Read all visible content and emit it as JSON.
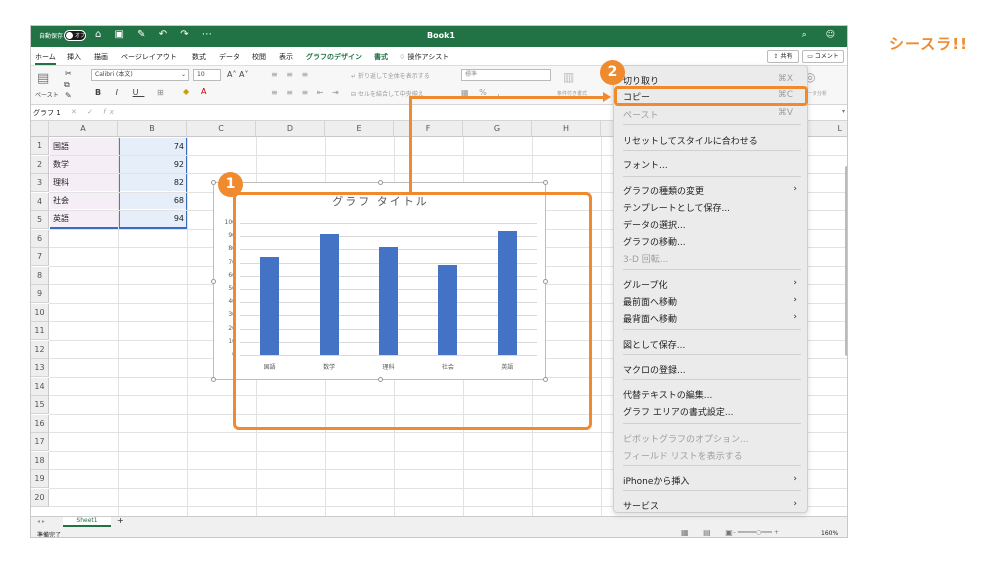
{
  "window": {
    "autosave_label": "自動保存",
    "autosave_state": "オフ",
    "title": "Book1"
  },
  "menu_tabs": [
    "ホーム",
    "挿入",
    "描画",
    "ページレイアウト",
    "数式",
    "データ",
    "校閲",
    "表示",
    "グラフのデザイン",
    "書式",
    "操作アシスト"
  ],
  "share_label": "共有",
  "comment_label": "コメント",
  "ribbon": {
    "paste_label": "ペースト",
    "font_name": "Calibri (本文)",
    "font_size": "10",
    "wrap_text": "折り返して全体を表示する",
    "merge_center": "セルを結合して中央揃え",
    "number_format": "標準",
    "cond_format": "条件付き書式",
    "data_analysis": "データ分析"
  },
  "formula_bar": {
    "name_box": "グラフ 1",
    "fx": "fx"
  },
  "columns": [
    "A",
    "B",
    "C",
    "D",
    "E",
    "F",
    "G",
    "H",
    "L"
  ],
  "rows": [
    "1",
    "2",
    "3",
    "4",
    "5",
    "6",
    "7",
    "8",
    "9",
    "10",
    "11",
    "12",
    "13",
    "14",
    "15",
    "16",
    "17",
    "18",
    "19",
    "20"
  ],
  "cells": [
    {
      "a": "国語",
      "b": "74"
    },
    {
      "a": "数学",
      "b": "92"
    },
    {
      "a": "理科",
      "b": "82"
    },
    {
      "a": "社会",
      "b": "68"
    },
    {
      "a": "英語",
      "b": "94"
    }
  ],
  "chart_data": {
    "type": "bar",
    "title": "グラフ タイトル",
    "categories": [
      "国語",
      "数学",
      "理科",
      "社会",
      "英語"
    ],
    "values": [
      74,
      92,
      82,
      68,
      94
    ],
    "yticks": [
      "100",
      "90",
      "80",
      "70",
      "60",
      "50",
      "40",
      "30",
      "20",
      "10",
      "0"
    ],
    "ylim": [
      0,
      100
    ],
    "bar_color": "#4472c4",
    "grid": true
  },
  "context_menu": {
    "items": [
      {
        "label": "切り取り",
        "shortcut": "⌘X",
        "disabled": false,
        "arrow": false
      },
      {
        "label": "コピー",
        "shortcut": "⌘C",
        "disabled": false,
        "arrow": false
      },
      {
        "label": "ペースト",
        "shortcut": "⌘V",
        "disabled": true,
        "arrow": false
      },
      {
        "label": "リセットしてスタイルに合わせる",
        "shortcut": "",
        "disabled": false,
        "arrow": false
      },
      {
        "label": "フォント...",
        "shortcut": "",
        "disabled": false,
        "arrow": false
      },
      {
        "label": "グラフの種類の変更",
        "shortcut": "",
        "disabled": false,
        "arrow": true
      },
      {
        "label": "テンプレートとして保存...",
        "shortcut": "",
        "disabled": false,
        "arrow": false
      },
      {
        "label": "データの選択...",
        "shortcut": "",
        "disabled": false,
        "arrow": false
      },
      {
        "label": "グラフの移動...",
        "shortcut": "",
        "disabled": false,
        "arrow": false
      },
      {
        "label": "3-D 回転...",
        "shortcut": "",
        "disabled": true,
        "arrow": false
      },
      {
        "label": "グループ化",
        "shortcut": "",
        "disabled": false,
        "arrow": true
      },
      {
        "label": "最前面へ移動",
        "shortcut": "",
        "disabled": false,
        "arrow": true
      },
      {
        "label": "最背面へ移動",
        "shortcut": "",
        "disabled": false,
        "arrow": true
      },
      {
        "label": "図として保存...",
        "shortcut": "",
        "disabled": false,
        "arrow": false
      },
      {
        "label": "マクロの登録...",
        "shortcut": "",
        "disabled": false,
        "arrow": false
      },
      {
        "label": "代替テキストの編集...",
        "shortcut": "",
        "disabled": false,
        "arrow": false
      },
      {
        "label": "グラフ エリアの書式設定...",
        "shortcut": "",
        "disabled": false,
        "arrow": false
      },
      {
        "label": "ピボットグラフのオプション...",
        "shortcut": "",
        "disabled": true,
        "arrow": false
      },
      {
        "label": "フィールド リストを表示する",
        "shortcut": "",
        "disabled": true,
        "arrow": false
      },
      {
        "label": "iPhoneから挿入",
        "shortcut": "",
        "disabled": false,
        "arrow": true
      },
      {
        "label": "サービス",
        "shortcut": "",
        "disabled": false,
        "arrow": true
      }
    ]
  },
  "sheet_tab": "Sheet1",
  "status_text": "準備完了",
  "zoom": "160%",
  "callouts": {
    "one": "1",
    "two": "2"
  },
  "brand": "シースラ!!",
  "accent_color": "#f08a2e",
  "titlebar_color": "#217346"
}
